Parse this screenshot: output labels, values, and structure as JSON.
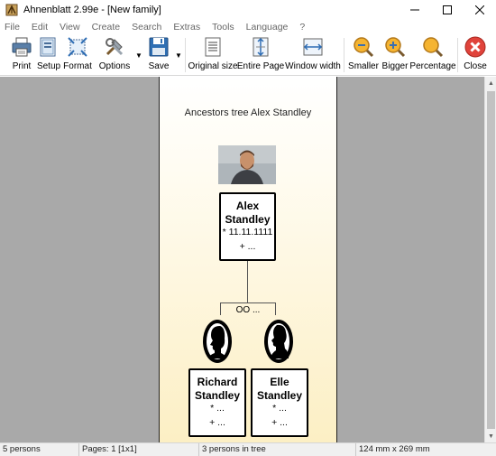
{
  "window": {
    "title": "Ahnenblatt 2.99e - [New family]"
  },
  "menu": [
    "File",
    "Edit",
    "View",
    "Create",
    "Search",
    "Extras",
    "Tools",
    "Language",
    "?"
  ],
  "toolbar": {
    "print": "Print",
    "setup": "Setup",
    "format": "Format",
    "options": "Options",
    "save": "Save",
    "original_size": "Original size",
    "entire_page": "Entire Page",
    "window_width": "Window width",
    "smaller": "Smaller",
    "bigger": "Bigger",
    "percentage": "Percentage",
    "close": "Close"
  },
  "tree": {
    "title": "Ancestors tree Alex Standley",
    "root": {
      "first": "Alex",
      "last": "Standley",
      "birth": "* 11.11.1111",
      "death": "+ ..."
    },
    "marriage": "OO ...",
    "father": {
      "first": "Richard",
      "last": "Standley",
      "birth": "* ...",
      "death": "+ ..."
    },
    "mother": {
      "first": "Elle",
      "last": "Standley",
      "birth": "* ...",
      "death": "+ ..."
    }
  },
  "status": {
    "persons": "5 persons",
    "pages": "Pages: 1 [1x1]",
    "in_tree": "3 persons in tree",
    "size": "124 mm x 269 mm"
  },
  "colors": {
    "workspace": "#a9a9a9",
    "page_gradient_bottom": "#fcefc4",
    "close_icon_red": "#e0433b",
    "zoom_icon_orange": "#f0a020"
  }
}
